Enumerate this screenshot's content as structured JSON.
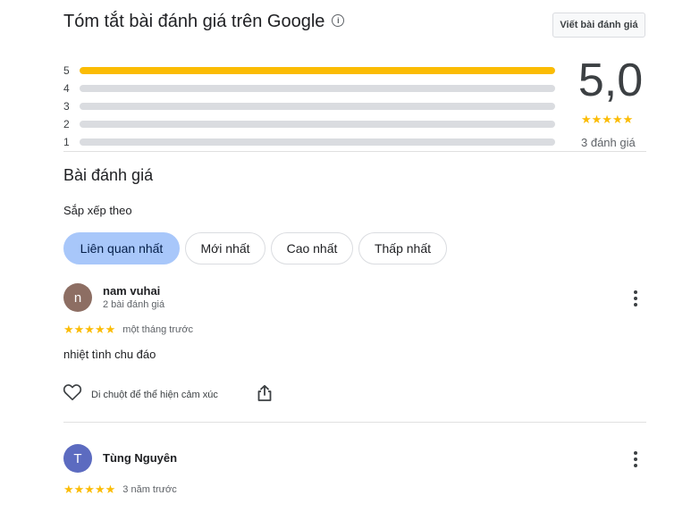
{
  "header": {
    "title": "Tóm tắt bài đánh giá trên Google",
    "info_icon": "i",
    "write_review_label": "Viết bài đánh giá"
  },
  "summary": {
    "score": "5,0",
    "stars": "★★★★★",
    "count_label": "3 đánh giá",
    "bars": [
      {
        "label": "5",
        "fraction": 1.0
      },
      {
        "label": "4",
        "fraction": 0.0
      },
      {
        "label": "3",
        "fraction": 0.0
      },
      {
        "label": "2",
        "fraction": 0.0
      },
      {
        "label": "1",
        "fraction": 0.0
      }
    ],
    "bar_color": "#fbbc04"
  },
  "reviews_section": {
    "title": "Bài đánh giá",
    "sort_label": "Sắp xếp theo",
    "sort_options": [
      {
        "label": "Liên quan nhất",
        "active": true
      },
      {
        "label": "Mới nhất",
        "active": false
      },
      {
        "label": "Cao nhất",
        "active": false
      },
      {
        "label": "Thấp nhất",
        "active": false
      }
    ]
  },
  "reviews": [
    {
      "avatar_letter": "n",
      "avatar_color": "#8d6e63",
      "name": "nam vuhai",
      "meta": "2 bài đánh giá",
      "stars": "★★★★★",
      "rating": 5,
      "time": "một tháng trước",
      "text": "nhiệt tình chu đáo",
      "react_label": "Di chuột để thể hiện cảm xúc"
    },
    {
      "avatar_letter": "T",
      "avatar_color": "#5c6bc0",
      "name": "Tùng Nguyên",
      "stars": "★★★★★",
      "rating": 5,
      "time": "3 năm trước"
    }
  ]
}
